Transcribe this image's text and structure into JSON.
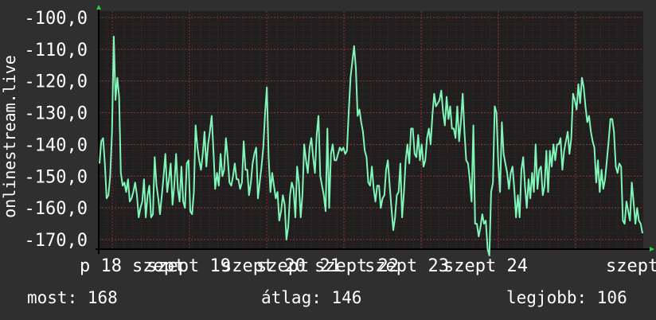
{
  "chart_data": {
    "type": "line",
    "ylabel": "onlinestream.live",
    "ylim": [
      -173,
      -98
    ],
    "yticks": [
      -100,
      -110,
      -120,
      -130,
      -140,
      -150,
      -160,
      -170
    ],
    "ytick_labels": [
      "-100,0",
      "-110,0",
      "-120,0",
      "-130,0",
      "-140,0",
      "-150,0",
      "-160,0",
      "-170,0"
    ],
    "xtick_labels": [
      "p 18",
      "szept",
      "szept 19",
      "szept 20",
      "szept 21",
      "szept 22",
      "szept 23",
      "szept 24",
      "szept"
    ],
    "grid": true,
    "colors": {
      "background": "#2f2f2f",
      "plot_background": "#1f1f1f",
      "line": "#7ff5b8",
      "grid": "#6a2a2a",
      "axis": "#000000",
      "arrow": "#2ecc40"
    },
    "series": [
      {
        "values": [
          -146,
          -139,
          -138,
          -146,
          -157,
          -156,
          -150,
          -136,
          -106,
          -126,
          -119,
          -125,
          -149,
          -153,
          -152,
          -155,
          -151,
          -158,
          -157,
          -155,
          -152,
          -156,
          -163,
          -160,
          -158,
          -151,
          -163,
          -156,
          -153,
          -163,
          -162,
          -144,
          -153,
          -157,
          -162,
          -156,
          -150,
          -143,
          -155,
          -151,
          -146,
          -159,
          -153,
          -143,
          -154,
          -158,
          -147,
          -158,
          -160,
          -146,
          -145,
          -161,
          -162,
          -155,
          -134,
          -141,
          -145,
          -148,
          -143,
          -136,
          -147,
          -140,
          -136,
          -131,
          -142,
          -154,
          -149,
          -153,
          -143,
          -150,
          -148,
          -138,
          -144,
          -152,
          -153,
          -150,
          -146,
          -151,
          -151,
          -154,
          -152,
          -139,
          -148,
          -148,
          -156,
          -152,
          -146,
          -143,
          -141,
          -157,
          -152,
          -147,
          -141,
          -130,
          -122,
          -144,
          -155,
          -149,
          -153,
          -157,
          -155,
          -164,
          -161,
          -156,
          -159,
          -170,
          -166,
          -156,
          -152,
          -154,
          -163,
          -147,
          -152,
          -163,
          -156,
          -140,
          -145,
          -149,
          -141,
          -138,
          -144,
          -149,
          -137,
          -131,
          -150,
          -153,
          -156,
          -161,
          -135,
          -160,
          -143,
          -140,
          -145,
          -145,
          -143,
          -141,
          -142,
          -141,
          -143,
          -142,
          -130,
          -119,
          -114,
          -109,
          -116,
          -131,
          -129,
          -133,
          -136,
          -142,
          -144,
          -152,
          -153,
          -147,
          -154,
          -158,
          -153,
          -153,
          -160,
          -157,
          -156,
          -148,
          -145,
          -153,
          -160,
          -167,
          -163,
          -156,
          -155,
          -146,
          -163,
          -155,
          -145,
          -140,
          -146,
          -135,
          -135,
          -143,
          -144,
          -137,
          -145,
          -140,
          -147,
          -145,
          -138,
          -135,
          -140,
          -131,
          -124,
          -128,
          -127,
          -126,
          -123,
          -130,
          -134,
          -125,
          -132,
          -128,
          -135,
          -135,
          -138,
          -128,
          -139,
          -133,
          -124,
          -136,
          -145,
          -146,
          -151,
          -158,
          -134,
          -165,
          -165,
          -169,
          -166,
          -162,
          -165,
          -164,
          -173,
          -175,
          -155,
          -152,
          -128,
          -130,
          -146,
          -155,
          -133,
          -143,
          -146,
          -149,
          -154,
          -149,
          -147,
          -154,
          -163,
          -156,
          -163,
          -148,
          -144,
          -153,
          -160,
          -151,
          -157,
          -149,
          -155,
          -140,
          -154,
          -148,
          -147,
          -156,
          -153,
          -142,
          -155,
          -142,
          -147,
          -140,
          -145,
          -140,
          -140,
          -138,
          -148,
          -142,
          -139,
          -136,
          -143,
          -138,
          -124,
          -126,
          -129,
          -121,
          -127,
          -119,
          -122,
          -128,
          -133,
          -131,
          -136,
          -139,
          -141,
          -152,
          -145,
          -155,
          -148,
          -154,
          -151,
          -145,
          -139,
          -132,
          -132,
          -136,
          -147,
          -149,
          -146,
          -147,
          -164,
          -165,
          -158,
          -161,
          -164,
          -152,
          -158,
          -165,
          -160,
          -164,
          -165,
          -168
        ]
      }
    ]
  },
  "stats": {
    "current": "most: 168",
    "average": "átlag: 146",
    "best": "legjobb: 106"
  }
}
